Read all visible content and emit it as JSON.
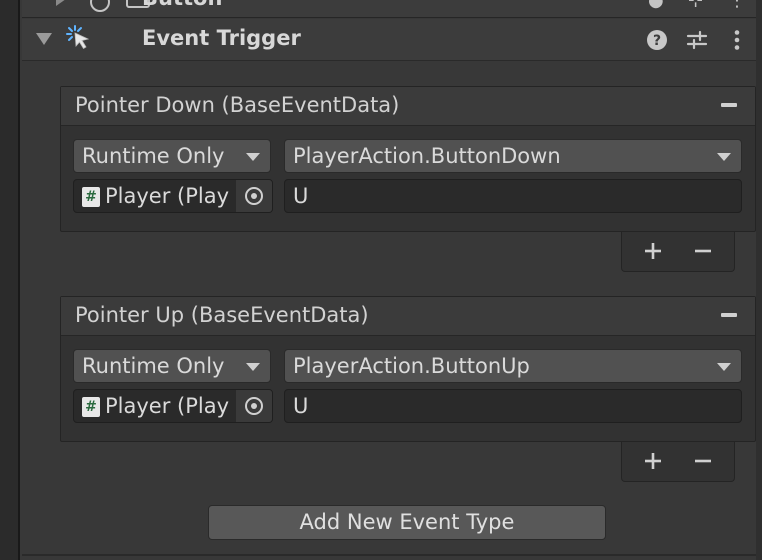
{
  "previous_component": {
    "title": "Button"
  },
  "component": {
    "title": "Event Trigger"
  },
  "events": [
    {
      "title": "Pointer Down (BaseEventData)",
      "call_state": "Runtime Only",
      "function": "PlayerAction.ButtonDown",
      "object": "Player (Play",
      "argument": "U"
    },
    {
      "title": "Pointer Up (BaseEventData)",
      "call_state": "Runtime Only",
      "function": "PlayerAction.ButtonUp",
      "object": "Player (Play",
      "argument": "U"
    }
  ],
  "add_button_label": "Add New Event Type",
  "icons": {
    "help": "help-icon",
    "presets": "presets-icon",
    "menu": "kebab-menu-icon",
    "script": "script-icon",
    "picker": "object-picker-icon"
  }
}
